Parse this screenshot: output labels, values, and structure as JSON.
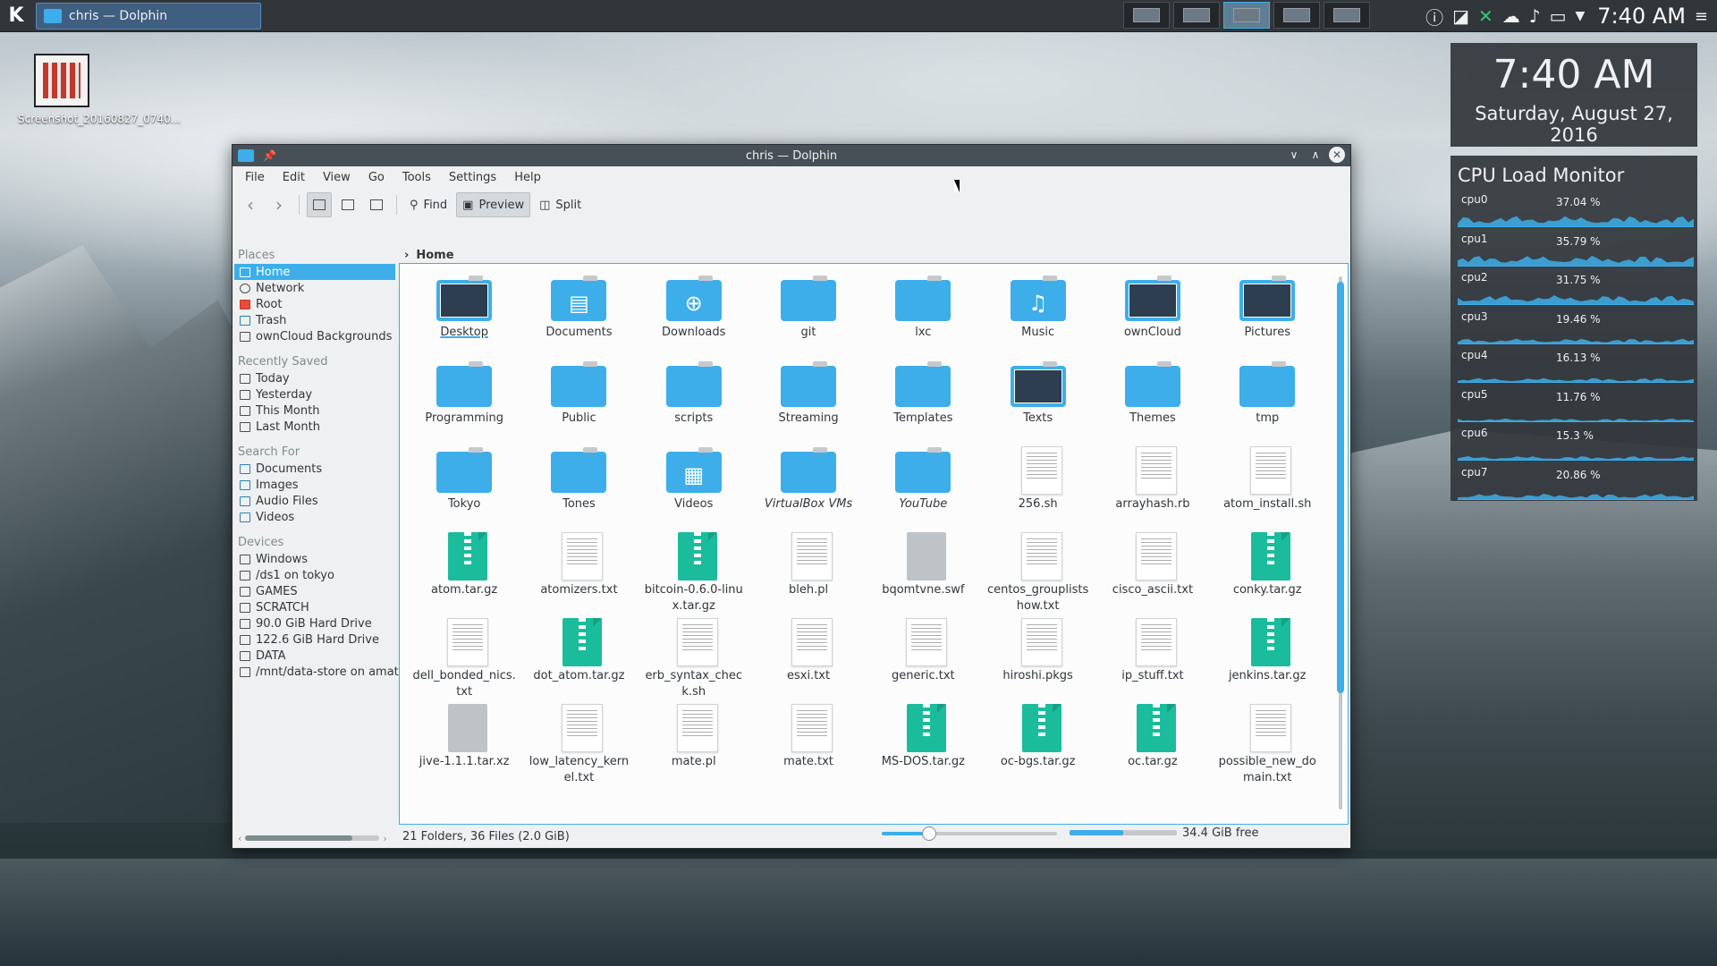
{
  "panel": {
    "task_label": "chris — Dolphin",
    "clock": "7:40 AM"
  },
  "desktop": {
    "icon_label": "Screenshot_20160827_0740..."
  },
  "clock_widget": {
    "time": "7:40 AM",
    "date": "Saturday, August 27, 2016"
  },
  "cpu_widget": {
    "title": "CPU Load Monitor",
    "cpus": [
      {
        "name": "cpu0",
        "value": "37.04 %",
        "level": 0.37
      },
      {
        "name": "cpu1",
        "value": "35.79 %",
        "level": 0.36
      },
      {
        "name": "cpu2",
        "value": "31.75 %",
        "level": 0.32
      },
      {
        "name": "cpu3",
        "value": "19.46 %",
        "level": 0.19
      },
      {
        "name": "cpu4",
        "value": "16.13 %",
        "level": 0.16
      },
      {
        "name": "cpu5",
        "value": "11.76 %",
        "level": 0.12
      },
      {
        "name": "cpu6",
        "value": "15.3 %",
        "level": 0.15
      },
      {
        "name": "cpu7",
        "value": "20.86 %",
        "level": 0.21
      }
    ]
  },
  "window": {
    "title": "chris — Dolphin",
    "menu": [
      "File",
      "Edit",
      "View",
      "Go",
      "Tools",
      "Settings",
      "Help"
    ],
    "toolbar": {
      "find": "Find",
      "preview": "Preview",
      "split": "Split"
    },
    "breadcrumb": "Home",
    "places": {
      "places_title": "Places",
      "places": [
        "Home",
        "Network",
        "Root",
        "Trash",
        "ownCloud Backgrounds"
      ],
      "recent_title": "Recently Saved",
      "recent": [
        "Today",
        "Yesterday",
        "This Month",
        "Last Month"
      ],
      "search_title": "Search For",
      "search": [
        "Documents",
        "Images",
        "Audio Files",
        "Videos"
      ],
      "devices_title": "Devices",
      "devices": [
        "Windows",
        "/ds1 on tokyo",
        "GAMES",
        "SCRATCH",
        "90.0 GiB Hard Drive",
        "122.6 GiB Hard Drive",
        "DATA",
        "/mnt/data-store on amate"
      ]
    },
    "files": [
      {
        "name": "Desktop",
        "kind": "folder-img"
      },
      {
        "name": "Documents",
        "kind": "folder",
        "glyph": "▤"
      },
      {
        "name": "Downloads",
        "kind": "folder",
        "glyph": "⊕"
      },
      {
        "name": "git",
        "kind": "folder"
      },
      {
        "name": "lxc",
        "kind": "folder"
      },
      {
        "name": "Music",
        "kind": "folder",
        "glyph": "♫"
      },
      {
        "name": "ownCloud",
        "kind": "folder-img"
      },
      {
        "name": "Pictures",
        "kind": "folder-img"
      },
      {
        "name": "Programming",
        "kind": "folder"
      },
      {
        "name": "Public",
        "kind": "folder"
      },
      {
        "name": "scripts",
        "kind": "folder"
      },
      {
        "name": "Streaming",
        "kind": "folder"
      },
      {
        "name": "Templates",
        "kind": "folder"
      },
      {
        "name": "Texts",
        "kind": "folder-img"
      },
      {
        "name": "Themes",
        "kind": "folder"
      },
      {
        "name": "tmp",
        "kind": "folder"
      },
      {
        "name": "Tokyo",
        "kind": "folder"
      },
      {
        "name": "Tones",
        "kind": "folder"
      },
      {
        "name": "Videos",
        "kind": "folder",
        "glyph": "▦"
      },
      {
        "name": "VirtualBox VMs",
        "kind": "folder",
        "italic": true
      },
      {
        "name": "YouTube",
        "kind": "folder",
        "italic": true
      },
      {
        "name": "256.sh",
        "kind": "doc"
      },
      {
        "name": "arrayhash.rb",
        "kind": "doc"
      },
      {
        "name": "atom_install.sh",
        "kind": "doc"
      },
      {
        "name": "atom.tar.gz",
        "kind": "arch"
      },
      {
        "name": "atomizers.txt",
        "kind": "doc"
      },
      {
        "name": "bitcoin-0.6.0-linux.tar.gz",
        "kind": "arch"
      },
      {
        "name": "bleh.pl",
        "kind": "doc"
      },
      {
        "name": "bqomtvne.swf",
        "kind": "blank"
      },
      {
        "name": "centos_grouplistshow.txt",
        "kind": "doc"
      },
      {
        "name": "cisco_ascii.txt",
        "kind": "doc"
      },
      {
        "name": "conky.tar.gz",
        "kind": "arch"
      },
      {
        "name": "dell_bonded_nics.txt",
        "kind": "doc"
      },
      {
        "name": "dot_atom.tar.gz",
        "kind": "arch"
      },
      {
        "name": "erb_syntax_check.sh",
        "kind": "doc"
      },
      {
        "name": "esxi.txt",
        "kind": "doc"
      },
      {
        "name": "generic.txt",
        "kind": "doc"
      },
      {
        "name": "hiroshi.pkgs",
        "kind": "doc"
      },
      {
        "name": "ip_stuff.txt",
        "kind": "doc"
      },
      {
        "name": "jenkins.tar.gz",
        "kind": "arch"
      },
      {
        "name": "jive-1.1.1.tar.xz",
        "kind": "blank"
      },
      {
        "name": "low_latency_kernel.txt",
        "kind": "doc"
      },
      {
        "name": "mate.pl",
        "kind": "doc"
      },
      {
        "name": "mate.txt",
        "kind": "doc"
      },
      {
        "name": "MS-DOS.tar.gz",
        "kind": "arch"
      },
      {
        "name": "oc-bgs.tar.gz",
        "kind": "arch"
      },
      {
        "name": "oc.tar.gz",
        "kind": "arch"
      },
      {
        "name": "possible_new_domain.txt",
        "kind": "doc"
      }
    ],
    "status_text": "21 Folders, 36 Files (2.0 GiB)",
    "free_text": "34.4 GiB free",
    "free_fraction": 0.5,
    "zoom_fraction": 0.27
  }
}
